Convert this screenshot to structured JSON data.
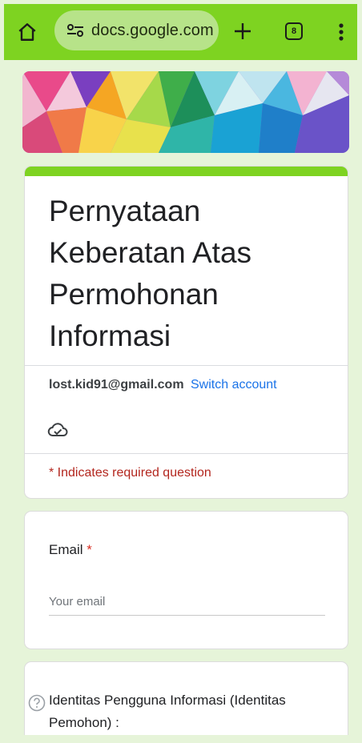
{
  "browser": {
    "url": "docs.google.com",
    "tab_count": "8",
    "accent_color": "#7ed321",
    "icons": [
      "home-icon",
      "tune-icon",
      "plus-icon",
      "tabs-icon",
      "more-vert-icon"
    ]
  },
  "form": {
    "title": "Pernyataan Keberatan Atas Permohonan Informasi",
    "account_email": "lost.kid91@gmail.com",
    "switch_account": "Switch account",
    "required_note": "* Indicates required question",
    "save_status_icon": "cloud-done-icon"
  },
  "questions": [
    {
      "label": "Email",
      "required_mark": "*",
      "placeholder": "Your email",
      "value": ""
    },
    {
      "label": "Identitas Pengguna Informasi (Identitas Pemohon) :",
      "help_icon": "help-icon"
    }
  ]
}
